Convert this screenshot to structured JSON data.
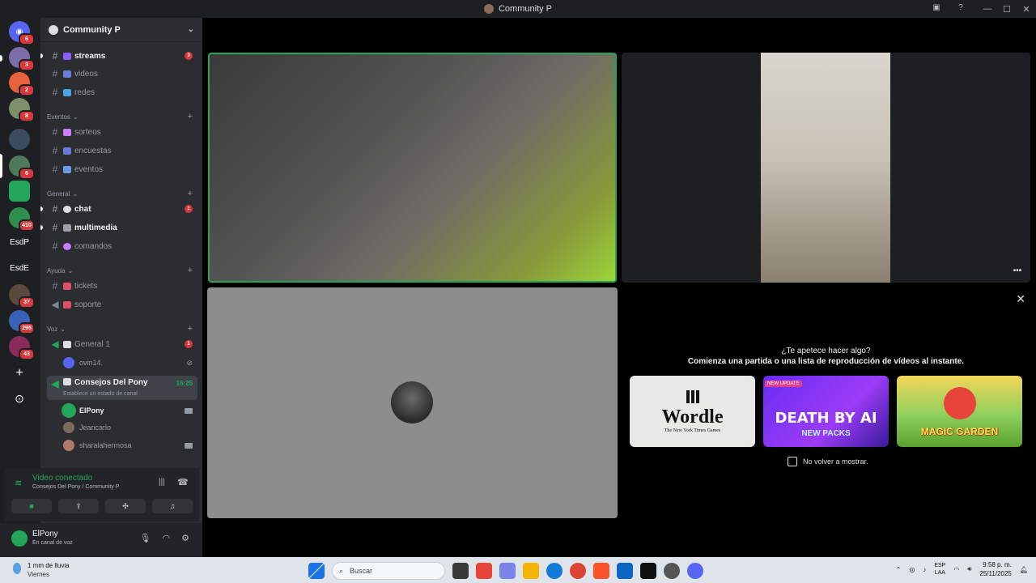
{
  "window": {
    "title": "Community P",
    "controls": [
      "—",
      "☐",
      "✕"
    ],
    "toolbar_icons": [
      "inbox-icon",
      "help-icon"
    ]
  },
  "rail": {
    "servers": [
      {
        "label": "",
        "badge": "6",
        "color": "#5865f2"
      },
      {
        "label": "",
        "badge": "3",
        "color": "#7b6ea8"
      },
      {
        "label": "",
        "badge": "2",
        "color": "#e8613a"
      },
      {
        "label": "",
        "badge": "8",
        "color": "#7d8f6a"
      },
      {
        "label": "",
        "badge": "",
        "color": "#3a4c5e"
      },
      {
        "label": "",
        "badge": "6",
        "color": "#4e7a5b"
      },
      {
        "label": "",
        "badge": "",
        "color": "#23a55a"
      },
      {
        "label": "",
        "badge": "410",
        "color": "#2f8f4e"
      },
      {
        "label": "EsdP",
        "badge": "",
        "color": "transparent"
      },
      {
        "label": "EsdE",
        "badge": "",
        "color": "transparent"
      },
      {
        "label": "",
        "badge": "37",
        "color": "#5a4a3e"
      },
      {
        "label": "",
        "badge": "295",
        "color": "#3a62b8"
      },
      {
        "label": "",
        "badge": "43",
        "color": "#8a2a5a"
      }
    ],
    "add_label": "+",
    "explore_label": "⊙"
  },
  "guild": {
    "name": "Community P",
    "chevron": "⌄"
  },
  "channels": {
    "top": [
      {
        "name": "streams",
        "bold": true,
        "badge": "3",
        "color": "#8b5cf6"
      },
      {
        "name": "videos",
        "bold": false,
        "badge": "",
        "color": "#6b7bd6"
      },
      {
        "name": "redes",
        "bold": false,
        "badge": "",
        "color": "#4aa3e6"
      }
    ],
    "eventos_label": "Eventos",
    "eventos": [
      {
        "name": "sorteos",
        "color": "#c77dff"
      },
      {
        "name": "encuestas",
        "color": "#6b7bd6"
      },
      {
        "name": "eventos",
        "color": "#6b9be6"
      }
    ],
    "general_label": "General",
    "general": [
      {
        "name": "chat",
        "bold": true,
        "badge": "1",
        "color": "#dbdee1"
      },
      {
        "name": "multimedia",
        "bold": true,
        "badge": "",
        "color": "#9aa0a6"
      },
      {
        "name": "comandos",
        "bold": false,
        "badge": "",
        "color": "#c77dff"
      }
    ],
    "ayuda_label": "Ayuda",
    "ayuda": [
      {
        "name": "tickets",
        "color": "#e04e6c"
      },
      {
        "name": "soporte",
        "color": "#e04e6c"
      }
    ],
    "voz_label": "Voz",
    "voice1": {
      "name": "General 1",
      "badge": "1"
    },
    "voice1_user": "ovin14.",
    "voice2": {
      "name": "Consejos Del Pony",
      "time": "16:25",
      "status": "Establece un estado de canal"
    },
    "voice2_users": [
      "ElPony",
      "Jeancarlo",
      "sharalahermosa"
    ]
  },
  "voice_panel": {
    "title": "Video conectado",
    "subtitle": "Consejos Del Pony / Community P",
    "buttons": [
      "camera-icon",
      "screen-share-icon",
      "activities-icon",
      "soundboard-icon"
    ]
  },
  "user": {
    "name": "ElPony",
    "status": "En canal de voz"
  },
  "activity": {
    "question": "¿Te apetece hacer algo?",
    "subtitle": "Comienza una partida o una lista de reproducción de vídeos al instante.",
    "wordle": {
      "name": "Wordle",
      "sub": "The New York Times Games"
    },
    "death": {
      "tag": "NEW UPDATE",
      "title": "DEATH BY AI",
      "sub": "NEW PACKS"
    },
    "magic": {
      "title": "MAGIC GARDEN"
    },
    "dont_show": "No volver a mostrar."
  },
  "taskbar": {
    "weather_line1": "1 mm de lluvia",
    "weather_line2": "Viernes",
    "search_placeholder": "Buscar",
    "lang1": "ESP",
    "lang2": "LAA",
    "time": "9:58 p. m.",
    "date": "25/11/2025",
    "apps": [
      "#e8453a",
      "#7b83eb",
      "#f4b400",
      "#0f7bd7",
      "#db4437",
      "#fb542b",
      "#0a66c2",
      "#111111",
      "#555555",
      "#5865f2"
    ]
  }
}
